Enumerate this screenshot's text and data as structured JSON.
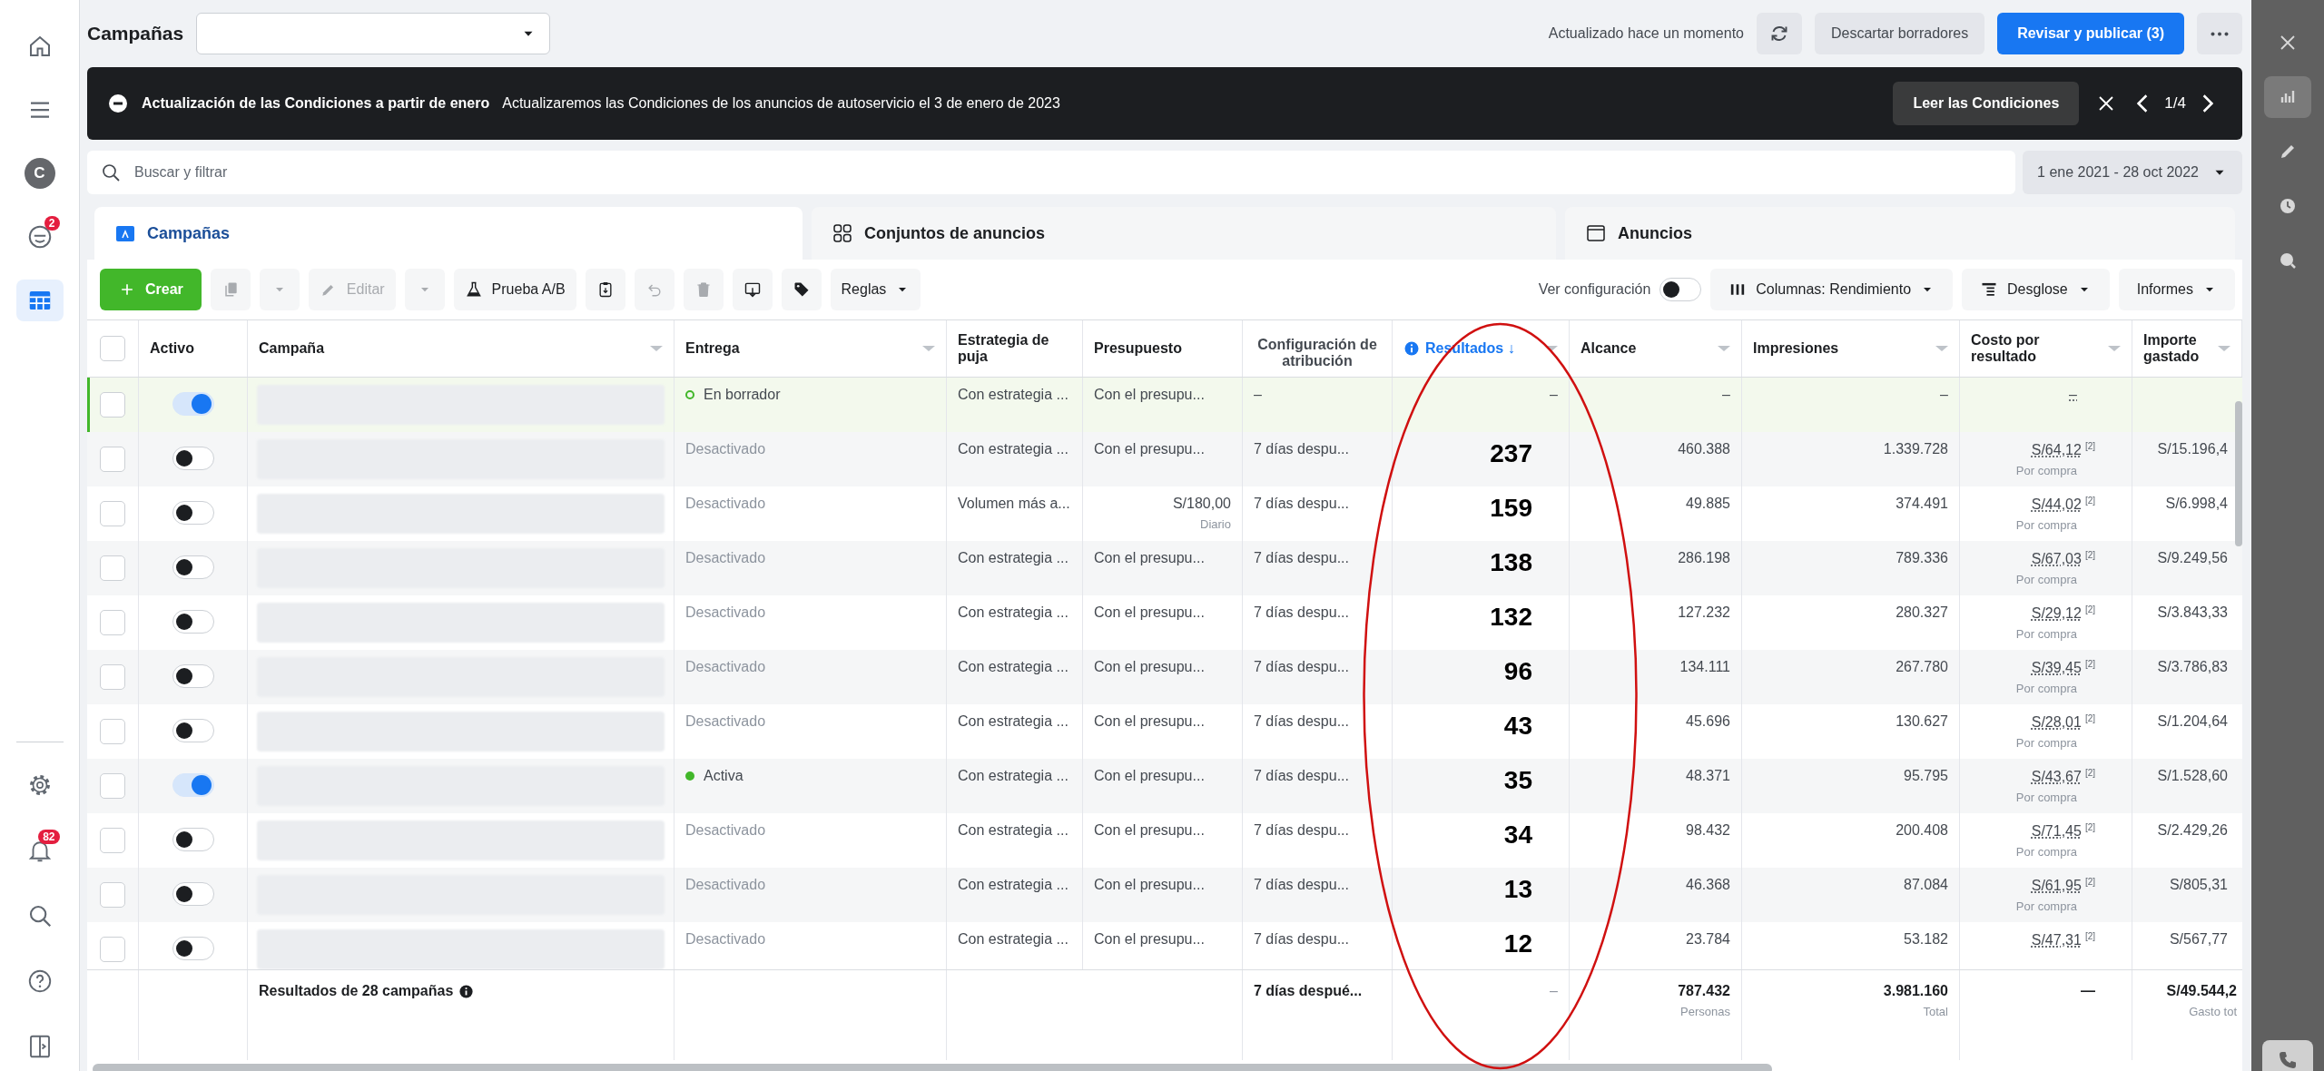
{
  "left_rail": {
    "top": [
      {
        "kind": "home",
        "selected": false
      },
      {
        "kind": "menu",
        "selected": false
      },
      {
        "kind": "avatar",
        "text": "C",
        "selected": false
      },
      {
        "kind": "alerts",
        "badge": "2",
        "selected": false
      },
      {
        "kind": "table",
        "selected": true
      }
    ],
    "bottom": [
      {
        "kind": "settings"
      },
      {
        "kind": "bell",
        "badge": "82"
      },
      {
        "kind": "search"
      },
      {
        "kind": "help"
      },
      {
        "kind": "panel"
      }
    ]
  },
  "top_bar": {
    "title": "Campañas",
    "status": "Actualizado hace un momento",
    "discard": "Descartar borradores",
    "publish": "Revisar y publicar (3)"
  },
  "banner": {
    "title": "Actualización de las Condiciones a partir de enero",
    "message": "Actualizaremos las Condiciones de los anuncios de autoservicio el 3 de enero de 2023",
    "action": "Leer las Condiciones",
    "pager": "1/4"
  },
  "search": {
    "placeholder": "Buscar y filtrar",
    "date_range": "1 ene 2021 - 28 oct 2022"
  },
  "tabs": [
    {
      "label": "Campañas",
      "kind": "campaigns",
      "selected": true
    },
    {
      "label": "Conjuntos de anuncios",
      "kind": "adsets",
      "selected": false
    },
    {
      "label": "Anuncios",
      "kind": "ads",
      "selected": false
    }
  ],
  "toolbar": {
    "left": [
      {
        "kind": "create",
        "label": "Crear",
        "disabled": false
      },
      {
        "kind": "duplicate",
        "disabled": true
      },
      {
        "kind": "caret",
        "disabled": true
      },
      {
        "kind": "edit",
        "label": "Editar",
        "disabled": true
      },
      {
        "kind": "caret",
        "disabled": true
      },
      {
        "kind": "ab-test",
        "label": "Prueba A/B",
        "disabled": false
      },
      {
        "kind": "clipboard",
        "disabled": false
      },
      {
        "kind": "undo",
        "disabled": true
      },
      {
        "kind": "delete",
        "disabled": true
      },
      {
        "kind": "export",
        "disabled": false
      },
      {
        "kind": "tag",
        "disabled": false
      },
      {
        "kind": "rules",
        "label": "Reglas",
        "disabled": false
      }
    ],
    "view_settings": {
      "label": "Ver configuración",
      "on": false
    },
    "right": [
      {
        "kind": "columns",
        "label": "Columnas: Rendimiento"
      },
      {
        "kind": "breakdown",
        "label": "Desglose"
      },
      {
        "kind": "reports",
        "label": "Informes"
      }
    ]
  },
  "table": {
    "all_checked": false,
    "columns": [
      {
        "label": "Activo",
        "sortable": false,
        "sorted": false
      },
      {
        "label": "Campaña",
        "sortable": true,
        "sorted": false
      },
      {
        "label": "Entrega",
        "sortable": true,
        "sorted": false
      },
      {
        "label": "Estrategia de puja",
        "sortable": false,
        "sorted": false
      },
      {
        "label": "Presupuesto",
        "sortable": false,
        "sorted": false
      },
      {
        "label": "Configuración de atribución",
        "sortable": false,
        "sorted": false
      },
      {
        "label": "Resultados ↓",
        "sortable": true,
        "sorted": true
      },
      {
        "label": "Alcance",
        "sortable": true,
        "sorted": false
      },
      {
        "label": "Impresiones",
        "sortable": true,
        "sorted": false
      },
      {
        "label": "Costo por resultado",
        "sortable": true,
        "sorted": false
      },
      {
        "label": "Importe gastado",
        "sortable": true,
        "sorted": false
      }
    ],
    "rows": [
      {
        "checked": false,
        "active": true,
        "status": {
          "kind": "draft",
          "text": "En borrador"
        },
        "strategy": "Con estrategia ...",
        "budget": "Con el presupu...",
        "attribution": "–",
        "results": "–",
        "reach": "–",
        "impressions": "–",
        "cost": "–"
      },
      {
        "checked": false,
        "active": false,
        "status": {
          "kind": "off",
          "text": "Desactivado"
        },
        "strategy": "Con estrategia ...",
        "budget": "Con el presupu...",
        "attribution": "7 días despu...",
        "results": "237",
        "reach": "460.388",
        "impressions": "1.339.728",
        "cost": "S/64,12",
        "cost_note": "[2]",
        "cost_sub": "Por compra",
        "spent": "S/15.196,4"
      },
      {
        "checked": false,
        "active": false,
        "status": {
          "kind": "off",
          "text": "Desactivado"
        },
        "strategy": "Volumen más a...",
        "budget": "S/180,00",
        "budget_sub": "Diario",
        "attribution": "7 días despu...",
        "results": "159",
        "reach": "49.885",
        "impressions": "374.491",
        "cost": "S/44,02",
        "cost_note": "[2]",
        "cost_sub": "Por compra",
        "spent": "S/6.998,4"
      },
      {
        "checked": false,
        "active": false,
        "status": {
          "kind": "off",
          "text": "Desactivado"
        },
        "strategy": "Con estrategia ...",
        "budget": "Con el presupu...",
        "attribution": "7 días despu...",
        "results": "138",
        "reach": "286.198",
        "impressions": "789.336",
        "cost": "S/67,03",
        "cost_note": "[2]",
        "cost_sub": "Por compra",
        "spent": "S/9.249,56"
      },
      {
        "checked": false,
        "active": false,
        "status": {
          "kind": "off",
          "text": "Desactivado"
        },
        "strategy": "Con estrategia ...",
        "budget": "Con el presupu...",
        "attribution": "7 días despu...",
        "results": "132",
        "reach": "127.232",
        "impressions": "280.327",
        "cost": "S/29,12",
        "cost_note": "[2]",
        "cost_sub": "Por compra",
        "spent": "S/3.843,33"
      },
      {
        "checked": false,
        "active": false,
        "status": {
          "kind": "off",
          "text": "Desactivado"
        },
        "strategy": "Con estrategia ...",
        "budget": "Con el presupu...",
        "attribution": "7 días despu...",
        "results": "96",
        "reach": "134.111",
        "impressions": "267.780",
        "cost": "S/39,45",
        "cost_note": "[2]",
        "cost_sub": "Por compra",
        "spent": "S/3.786,83"
      },
      {
        "checked": false,
        "active": false,
        "status": {
          "kind": "off",
          "text": "Desactivado"
        },
        "strategy": "Con estrategia ...",
        "budget": "Con el presupu...",
        "attribution": "7 días despu...",
        "results": "43",
        "reach": "45.696",
        "impressions": "130.627",
        "cost": "S/28,01",
        "cost_note": "[2]",
        "cost_sub": "Por compra",
        "spent": "S/1.204,64"
      },
      {
        "checked": false,
        "active": true,
        "status": {
          "kind": "active",
          "text": "Activa"
        },
        "strategy": "Con estrategia ...",
        "budget": "Con el presupu...",
        "attribution": "7 días despu...",
        "results": "35",
        "reach": "48.371",
        "impressions": "95.795",
        "cost": "S/43,67",
        "cost_note": "[2]",
        "cost_sub": "Por compra",
        "spent": "S/1.528,60"
      },
      {
        "checked": false,
        "active": false,
        "status": {
          "kind": "off",
          "text": "Desactivado"
        },
        "strategy": "Con estrategia ...",
        "budget": "Con el presupu...",
        "attribution": "7 días despu...",
        "results": "34",
        "reach": "98.432",
        "impressions": "200.408",
        "cost": "S/71,45",
        "cost_note": "[2]",
        "cost_sub": "Por compra",
        "spent": "S/2.429,26"
      },
      {
        "checked": false,
        "active": false,
        "status": {
          "kind": "off",
          "text": "Desactivado"
        },
        "strategy": "Con estrategia ...",
        "budget": "Con el presupu...",
        "attribution": "7 días despu...",
        "results": "13",
        "reach": "46.368",
        "impressions": "87.084",
        "cost": "S/61,95",
        "cost_note": "[2]",
        "cost_sub": "Por compra",
        "spent": "S/805,31"
      },
      {
        "checked": false,
        "active": false,
        "status": {
          "kind": "off",
          "text": "Desactivado"
        },
        "strategy": "Con estrategia ...",
        "budget": "Con el presupu...",
        "attribution": "7 días despu...",
        "results": "12",
        "reach": "23.784",
        "impressions": "53.182",
        "cost": "S/47,31",
        "cost_note": "[2]",
        "spent": "S/567,77"
      }
    ],
    "footer": {
      "label": "Resultados de 28 campañas",
      "attribution": "7 días despué...",
      "results": "–",
      "reach": "787.432",
      "reach_sub": "Personas",
      "impressions": "3.981.160",
      "impressions_sub": "Total",
      "cost": "—",
      "spent": "S/49.544,2",
      "spent_sub": "Gasto tot"
    }
  },
  "right_rail": {
    "top": [
      {
        "kind": "close",
        "selected": false
      },
      {
        "kind": "chart",
        "selected": true
      },
      {
        "kind": "pencil",
        "selected": false
      },
      {
        "kind": "clock",
        "selected": false
      },
      {
        "kind": "zoom",
        "selected": false
      }
    ],
    "bottom": [
      {
        "kind": "phone"
      }
    ]
  }
}
